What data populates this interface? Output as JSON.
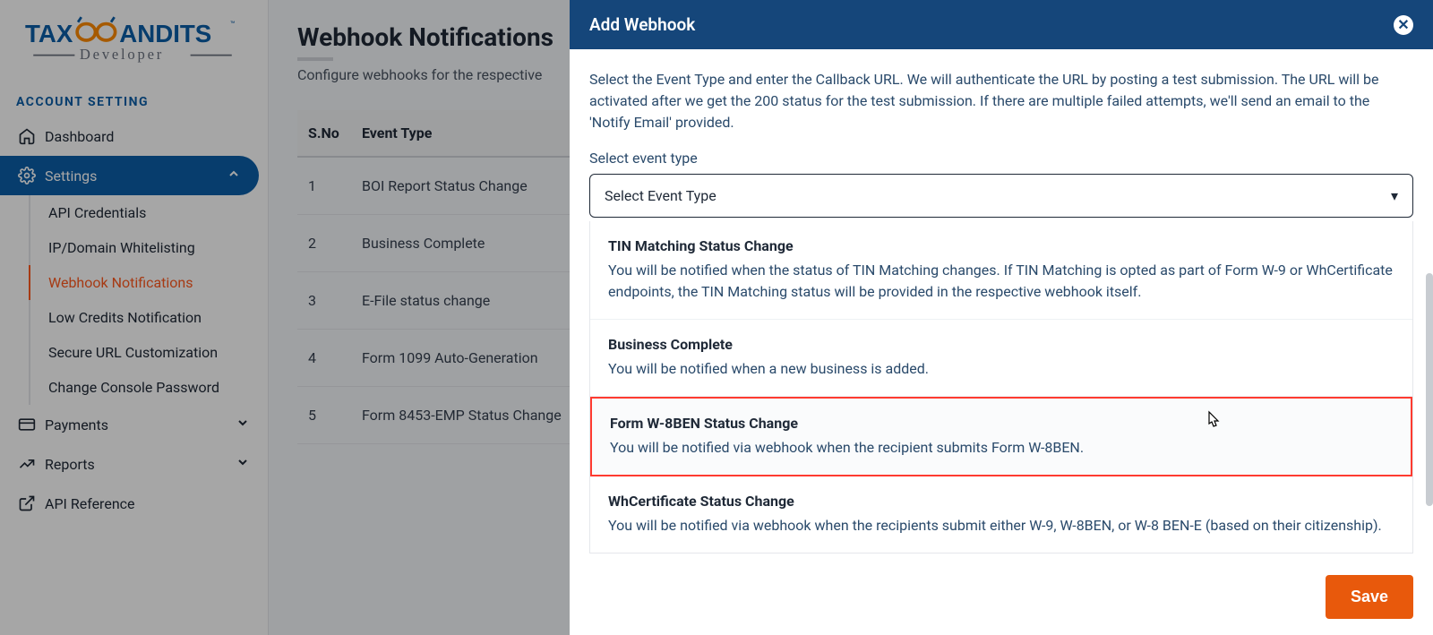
{
  "logo": {
    "brand_main": "TAX",
    "brand_rest": "ANDITS",
    "tm": "™",
    "tagline": "Developer"
  },
  "sidebar": {
    "section": "ACCOUNT SETTING",
    "nav": {
      "dashboard": "Dashboard",
      "settings": "Settings",
      "settings_items": [
        "API Credentials",
        "IP/Domain Whitelisting",
        "Webhook Notifications",
        "Low Credits Notification",
        "Secure URL Customization",
        "Change Console Password"
      ],
      "payments": "Payments",
      "reports": "Reports",
      "api_reference": "API Reference"
    }
  },
  "main": {
    "title": "Webhook Notifications",
    "subtitle": "Configure webhooks for the respective",
    "columns": {
      "sno": "S.No",
      "event_type": "Event Type"
    },
    "rows": [
      {
        "n": "1",
        "t": "BOI Report Status Change"
      },
      {
        "n": "2",
        "t": "Business Complete"
      },
      {
        "n": "3",
        "t": "E-File status change"
      },
      {
        "n": "4",
        "t": "Form 1099 Auto-Generation"
      },
      {
        "n": "5",
        "t": "Form 8453-EMP Status Change"
      }
    ]
  },
  "modal": {
    "title": "Add Webhook",
    "description": "Select the Event Type and enter the Callback URL. We will authenticate the URL by posting a test submission. The URL will be activated after we get the 200 status for the test submission. If there are multiple failed attempts, we'll send an email to the 'Notify Email' provided.",
    "select_label": "Select event type",
    "select_placeholder": "Select Event Type",
    "options": [
      {
        "title": "TIN Matching Status Change",
        "desc": "You will be notified when the status of TIN Matching changes. If TIN Matching is opted as part of Form W-9 or WhCertificate endpoints, the TIN Matching status will be provided in the respective webhook itself."
      },
      {
        "title": "Business Complete",
        "desc": "You will be notified when a new business is added."
      },
      {
        "title": "Form W-8BEN Status Change",
        "desc": "You will be notified via webhook when the recipient submits Form W-8BEN."
      },
      {
        "title": "WhCertificate Status Change",
        "desc": "You will be notified via webhook when the recipients submit either W-9, W-8BEN, or W-8 BEN-E (based on their citizenship)."
      }
    ],
    "save": "Save"
  }
}
